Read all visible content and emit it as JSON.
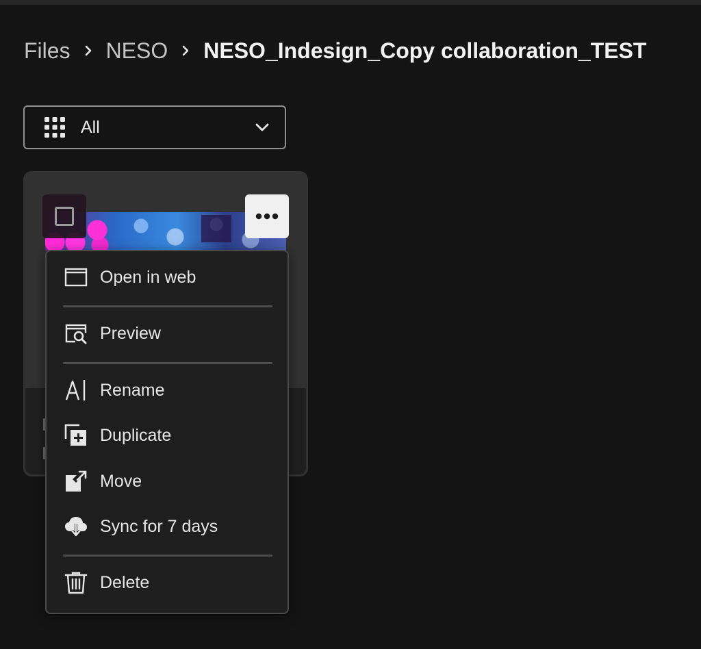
{
  "breadcrumb": {
    "items": [
      "Files",
      "NESO"
    ],
    "current": "NESO_Indesign_Copy collaboration_TEST"
  },
  "filter": {
    "selected": "All",
    "icon": "grid-icon"
  },
  "card": {
    "more_icon": "more-horizontal-icon",
    "checkbox_icon": "checkbox-icon"
  },
  "menu": {
    "items": [
      {
        "label": "Open in web",
        "icon": "browser-window-icon"
      },
      {
        "label": "Preview",
        "icon": "preview-icon"
      },
      {
        "label": "Rename",
        "icon": "rename-icon"
      },
      {
        "label": "Duplicate",
        "icon": "duplicate-icon"
      },
      {
        "label": "Move",
        "icon": "move-icon"
      },
      {
        "label": "Sync for 7 days",
        "icon": "cloud-sync-icon"
      },
      {
        "label": "Delete",
        "icon": "trash-icon"
      }
    ]
  },
  "colors": {
    "background": "#141414",
    "card": "#313131",
    "menu": "#1e1e1e",
    "accent_magenta": "#ff2bd6"
  }
}
